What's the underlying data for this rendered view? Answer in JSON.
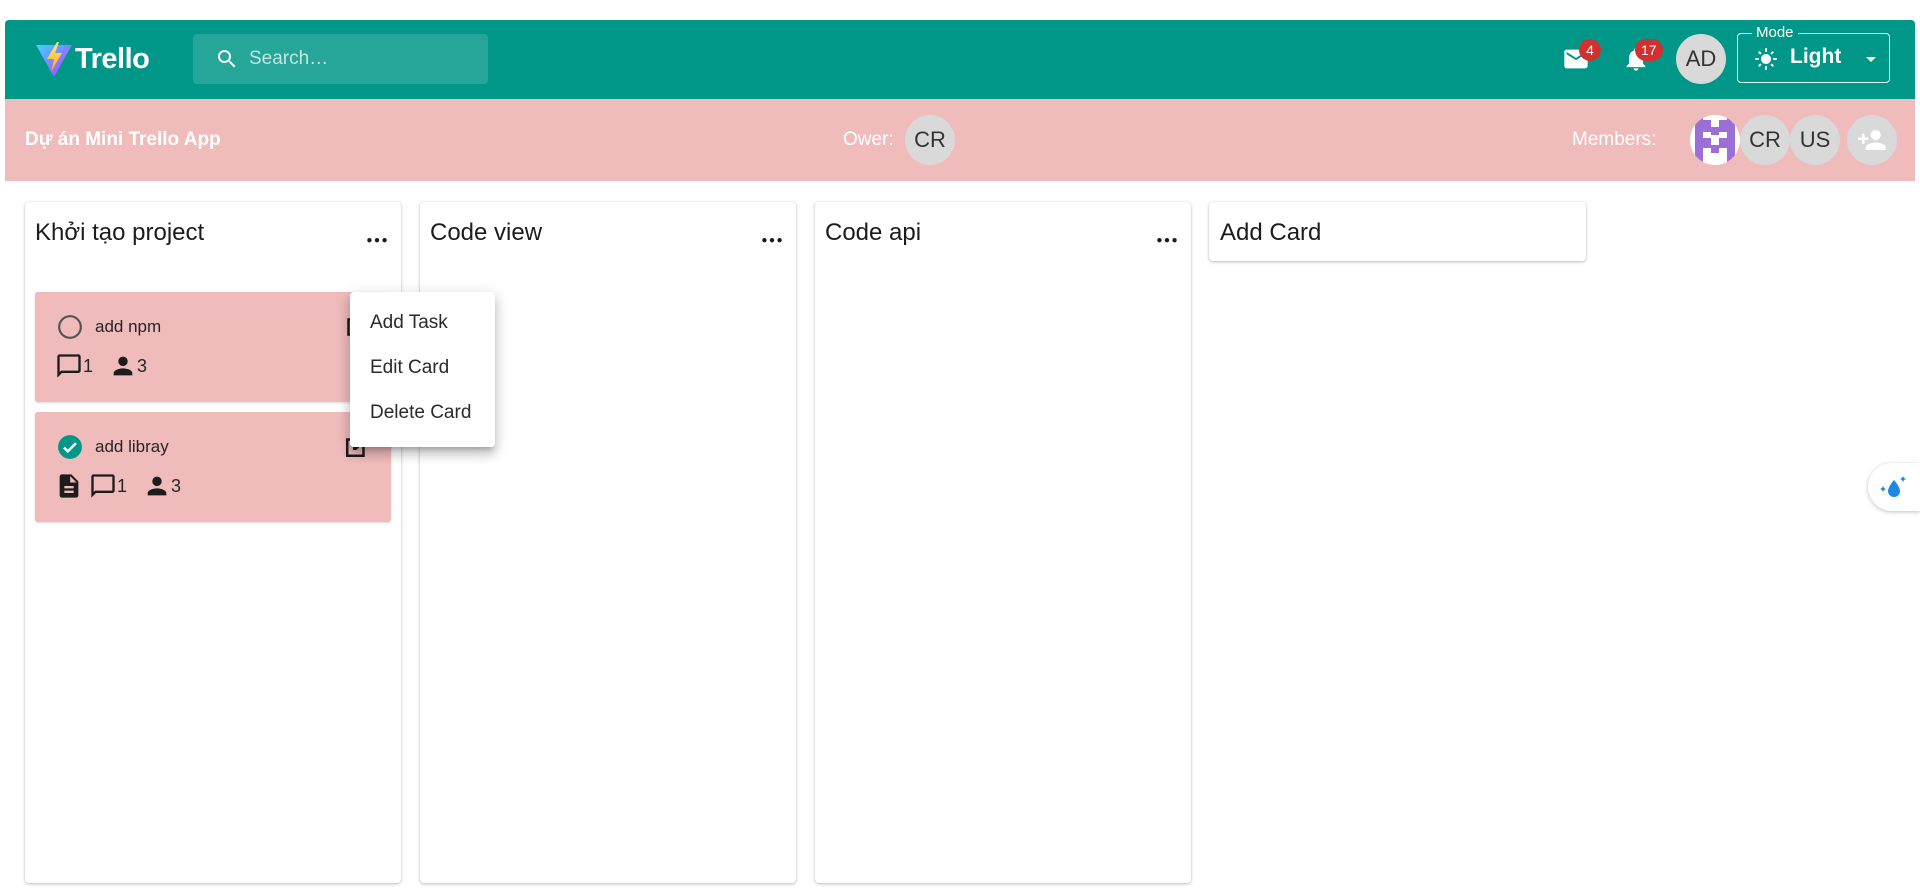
{
  "app": {
    "logo_text": "Trello",
    "search_placeholder": "Search…",
    "mail_badge": "4",
    "notification_badge": "17",
    "user_initials": "AD",
    "mode": {
      "legend": "Mode",
      "value": "Light"
    }
  },
  "board": {
    "title": "Dự án Mini Trello App",
    "owner_label": "Ower:",
    "owner_initials": "CR",
    "members_label": "Members:",
    "members": [
      "CR",
      "US"
    ]
  },
  "columns": [
    {
      "title": "Khởi tạo project",
      "tasks": [
        {
          "name": "add npm",
          "done": false,
          "comments": "1",
          "members": "3",
          "has_description": false
        },
        {
          "name": "add libray",
          "done": true,
          "comments": "1",
          "members": "3",
          "has_description": true
        }
      ]
    },
    {
      "title": "Code view",
      "tasks": []
    },
    {
      "title": "Code api",
      "tasks": []
    }
  ],
  "add_card_label": "Add Card",
  "card_menu": {
    "items": [
      "Add Task",
      "Edit Card",
      "Delete Card"
    ]
  },
  "colors": {
    "primary": "#009688",
    "board_bar": "#efbbbb",
    "badge": "#d32f2f",
    "task_bg": "#efbbbb"
  },
  "icons": [
    "search-icon",
    "mail-icon",
    "bell-icon",
    "sun-icon",
    "caret-down-icon",
    "more-horiz-icon",
    "comment-icon",
    "person-icon",
    "description-icon",
    "edit-icon",
    "person-add-icon",
    "check-circle-icon",
    "circle-outline-icon"
  ]
}
